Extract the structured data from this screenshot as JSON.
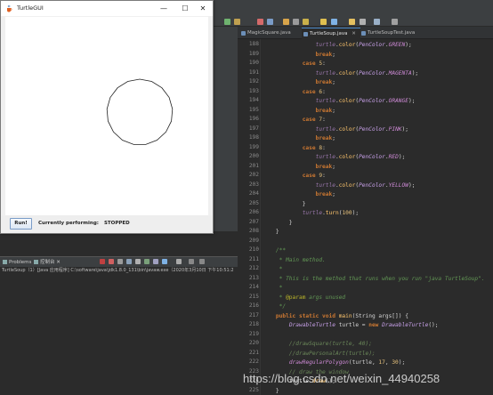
{
  "window": {
    "title": "TurtleGUI",
    "minimize_glyph": "—",
    "maximize_glyph": "☐",
    "close_glyph": "✕",
    "run_label": "Run!",
    "status_label": "Currently performing:",
    "status_value": "STOPPED",
    "drawing": {
      "shape": "regular polygon",
      "sides": 17,
      "side_length": 30
    }
  },
  "editor": {
    "tabs": [
      {
        "label": "MagicSquare.java",
        "active": false
      },
      {
        "label": "TurtleSoup.java",
        "active": true
      },
      {
        "label": "TurtleSoupTest.java",
        "active": false
      }
    ],
    "line_numbers": [
      "188",
      "189",
      "190",
      "191",
      "192",
      "193",
      "194",
      "195",
      "196",
      "197",
      "198",
      "199",
      "200",
      "201",
      "202",
      "203",
      "204",
      "205",
      "206",
      "207",
      "208",
      "209",
      "210",
      "211",
      "212",
      "213",
      "214",
      "215",
      "216",
      "217",
      "218",
      "219",
      "220",
      "221",
      "222",
      "223",
      "224",
      "225",
      "226"
    ]
  },
  "console": {
    "tabs": [
      "Problems",
      "控制台"
    ],
    "status": "TurtleSoup（1）[Java 应用程序] C:\\software\\java\\jdk1.8.0_131\\bin\\javaw.exe（2020年3月10日 下午10:51:2"
  },
  "watermark": "https://blog.csdn.net/weixin_44940258",
  "colors": {
    "editor_bg": "#2b2b2b",
    "keyword": "#cc7832",
    "color_const": "#ce8ad6",
    "comment": "#6a8759"
  }
}
